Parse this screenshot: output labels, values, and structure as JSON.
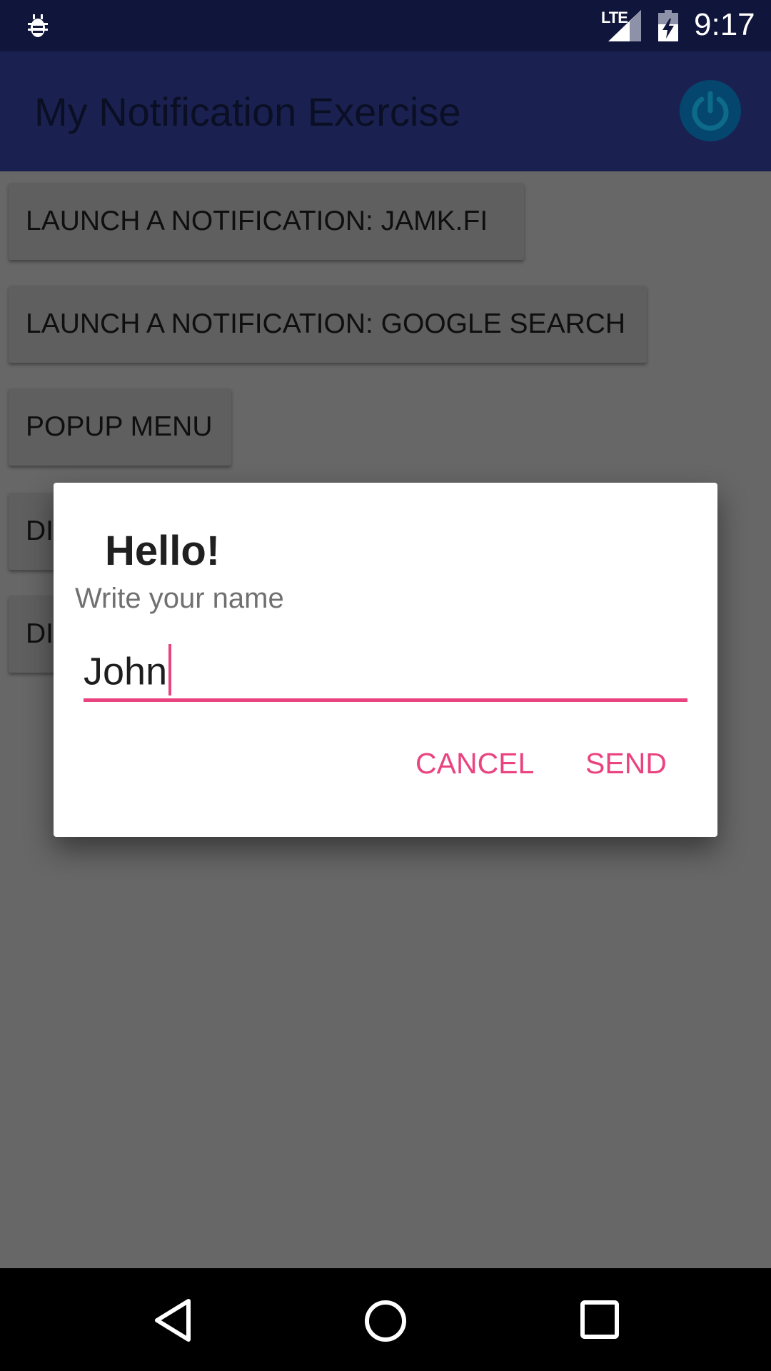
{
  "status_bar": {
    "network_type": "LTE",
    "clock": "9:17",
    "icons": [
      "bug-icon",
      "signal-icon",
      "battery-charging-icon"
    ]
  },
  "app_bar": {
    "title": "My Notification Exercise",
    "action_icon": "power-icon"
  },
  "buttons": [
    {
      "label": "LAUNCH A NOTIFICATION: JAMK.FI"
    },
    {
      "label": "LAUNCH A NOTIFICATION: GOOGLE SEARCH"
    },
    {
      "label": "POPUP MENU"
    },
    {
      "label": "DI"
    },
    {
      "label": "DI"
    }
  ],
  "dialog": {
    "title": "Hello!",
    "message": "Write your name",
    "input_value": "John",
    "cancel_label": "CANCEL",
    "send_label": "SEND"
  },
  "nav_bar": {
    "icons": [
      "back-icon",
      "home-icon",
      "recents-icon"
    ]
  },
  "colors": {
    "accent": "#ea4480",
    "primary": "#1a2150",
    "status_bar": "#10153c",
    "scrim": "#676767"
  }
}
